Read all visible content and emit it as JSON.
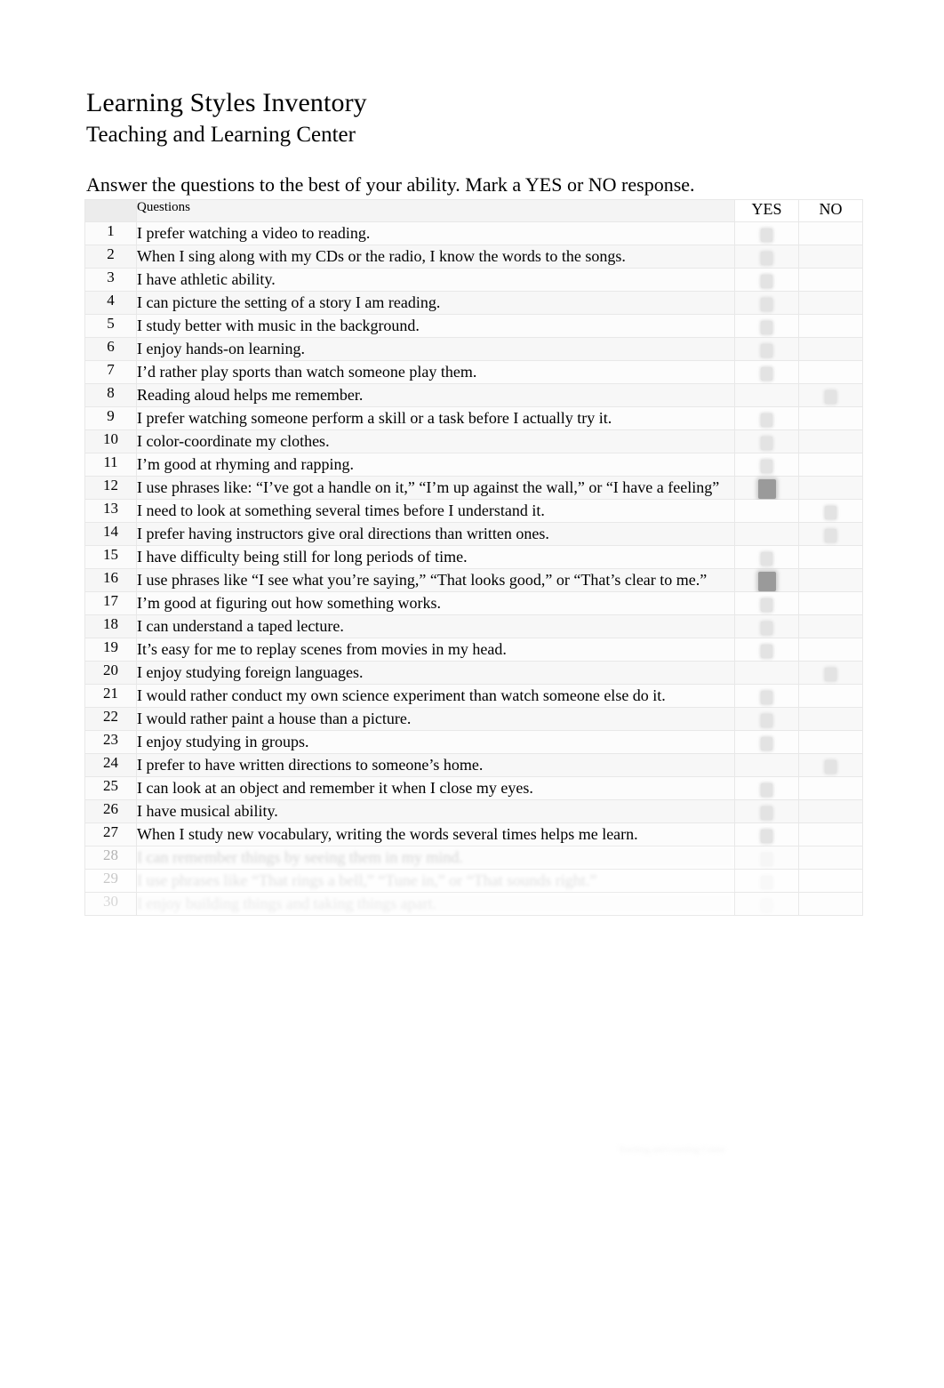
{
  "document": {
    "title": "Learning Styles Inventory",
    "subtitle": "Teaching and Learning Center",
    "instructions": "Answer the questions to the best of your ability. Mark a YES or NO response."
  },
  "table": {
    "headers": {
      "number": "",
      "questions": "Questions",
      "yes": "YES",
      "no": "NO"
    },
    "rows": [
      {
        "num": "1",
        "text": "I prefer watching a video to reading.",
        "yes": "faint",
        "no": "none"
      },
      {
        "num": "2",
        "text": "When I sing along with my CDs or the radio, I know the words to the songs.",
        "yes": "faint",
        "no": "none"
      },
      {
        "num": "3",
        "text": "I have athletic ability.",
        "yes": "faint",
        "no": "none"
      },
      {
        "num": "4",
        "text": "I can picture the setting of a story I am reading.",
        "yes": "faint",
        "no": "none"
      },
      {
        "num": "5",
        "text": "I study better with music in the background.",
        "yes": "faint",
        "no": "none"
      },
      {
        "num": "6",
        "text": "I enjoy hands-on learning.",
        "yes": "faint",
        "no": "none"
      },
      {
        "num": "7",
        "text": "I’d rather play sports than watch someone play them.",
        "yes": "faint",
        "no": "none"
      },
      {
        "num": "8",
        "text": "Reading aloud helps me remember.",
        "yes": "none",
        "no": "faint"
      },
      {
        "num": "9",
        "text": "I prefer watching someone perform a skill or a task before I actually try it.",
        "yes": "faint",
        "no": "none"
      },
      {
        "num": "10",
        "text": "I color-coordinate my clothes.",
        "yes": "faint",
        "no": "none"
      },
      {
        "num": "11",
        "text": "I’m good at rhyming and rapping.",
        "yes": "faint",
        "no": "none"
      },
      {
        "num": "12",
        "text": "I use phrases like: “I’ve got a handle on it,” “I’m up against the wall,” or “I have a feeling”",
        "yes": "dark",
        "no": "none"
      },
      {
        "num": "13",
        "text": "I need to look at something several times before I understand it.",
        "yes": "none",
        "no": "faint"
      },
      {
        "num": "14",
        "text": "I prefer having instructors give oral directions than written ones.",
        "yes": "none",
        "no": "faint"
      },
      {
        "num": "15",
        "text": "I have difficulty being still for long periods of time.",
        "yes": "faint",
        "no": "none"
      },
      {
        "num": "16",
        "text": "I use phrases like “I see what you’re saying,” “That looks good,” or “That’s clear to me.”",
        "yes": "dark",
        "no": "none"
      },
      {
        "num": "17",
        "text": "I’m good at figuring out how something works.",
        "yes": "faint",
        "no": "none"
      },
      {
        "num": "18",
        "text": "I can understand a taped lecture.",
        "yes": "faint",
        "no": "none"
      },
      {
        "num": "19",
        "text": "It’s easy for me to replay scenes from movies in my head.",
        "yes": "faint",
        "no": "none"
      },
      {
        "num": "20",
        "text": "I enjoy studying foreign languages.",
        "yes": "none",
        "no": "faint"
      },
      {
        "num": "21",
        "text": "I would rather conduct my own science experiment than watch someone else do it.",
        "yes": "faint",
        "no": "none"
      },
      {
        "num": "22",
        "text": "I would rather paint a house than a picture.",
        "yes": "faint",
        "no": "none"
      },
      {
        "num": "23",
        "text": "I enjoy studying in groups.",
        "yes": "faint",
        "no": "none"
      },
      {
        "num": "24",
        "text": "I prefer to have written directions to someone’s home.",
        "yes": "none",
        "no": "faint"
      },
      {
        "num": "25",
        "text": "I can look at an object and remember it when I close my eyes.",
        "yes": "faint",
        "no": "none"
      },
      {
        "num": "26",
        "text": "I have musical ability.",
        "yes": "faint",
        "no": "none"
      },
      {
        "num": "27",
        "text": "When I study new vocabulary, writing the words several times helps me learn.",
        "yes": "faint",
        "no": "none"
      },
      {
        "num": "28",
        "text": "I can remember things by seeing them in my mind.",
        "yes": "faint",
        "no": "none",
        "fade": "fade-1"
      },
      {
        "num": "29",
        "text": "I use phrases like “That rings a bell,” “Tune in,” or “That sounds right.”",
        "yes": "faint",
        "no": "none",
        "fade": "fade-2"
      },
      {
        "num": "30",
        "text": "I enjoy building things and taking things apart.",
        "yes": "faint",
        "no": "none",
        "fade": "fade-3"
      }
    ]
  },
  "footer": {
    "note": "Teaching and Learning Center"
  }
}
